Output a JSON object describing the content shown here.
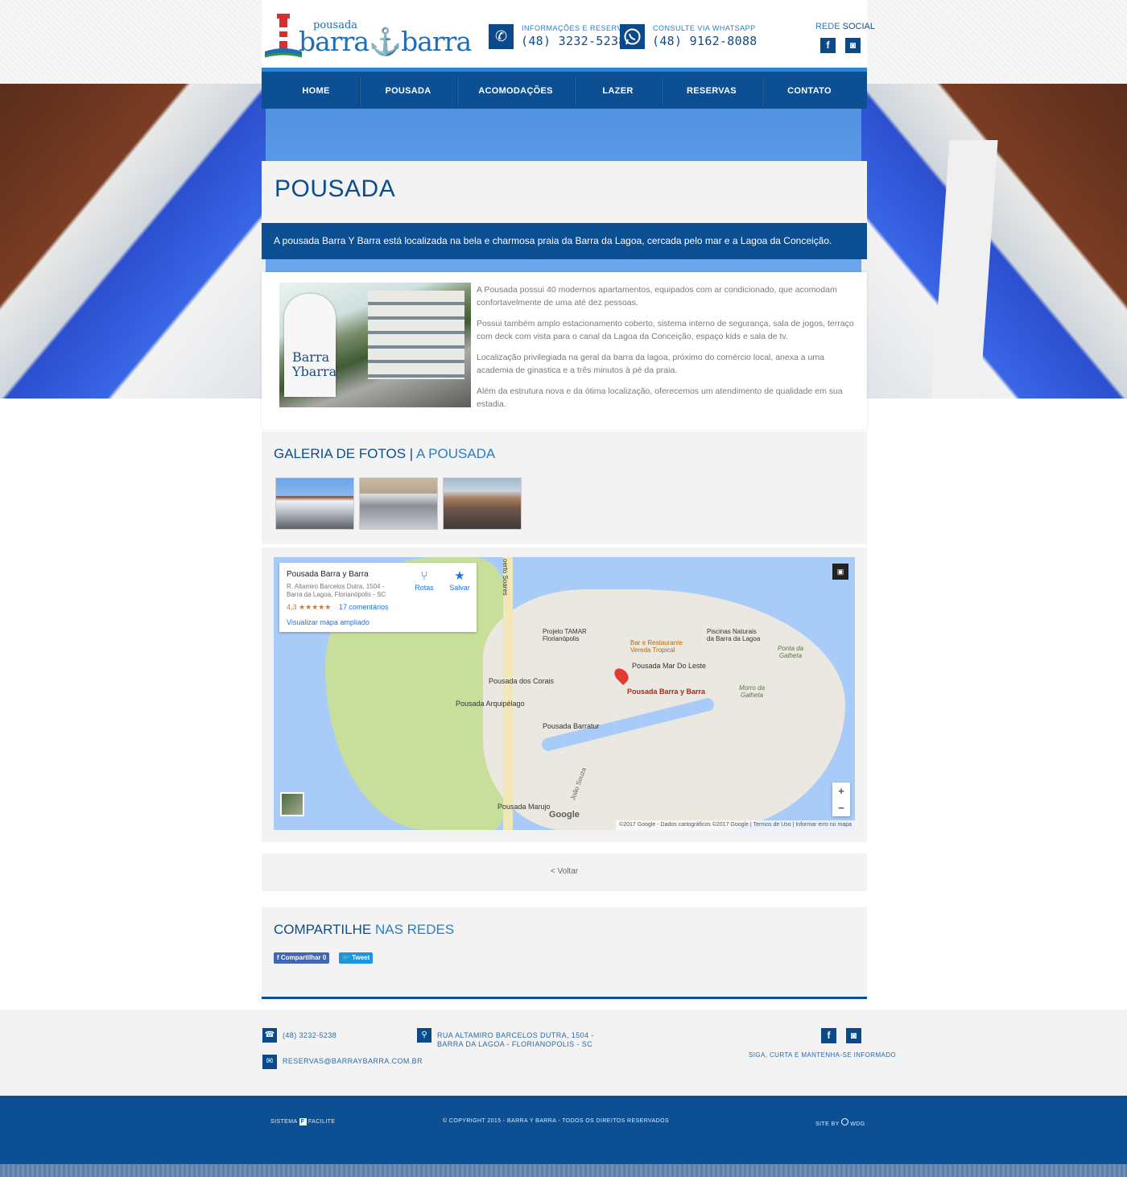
{
  "header": {
    "logo_small": "pousada",
    "logo_main": "barra⚓barra",
    "phone_label": "INFORMAÇÕES E RESERVAS",
    "phone_number": "(48) 3232-5238",
    "whatsapp_label": "CONSULTE VIA WHATSAPP",
    "whatsapp_number": "(48) 9162-8088",
    "social_a": "REDE",
    "social_b": "SOCIAL"
  },
  "nav": {
    "items": [
      "HOME",
      "POUSADA",
      "ACOMODAÇÕES",
      "LAZER",
      "RESERVAS",
      "CONTATO"
    ]
  },
  "page": {
    "title": "POUSADA",
    "intro": "A pousada Barra Y Barra está localizada na bela e charmosa praia da Barra da Lagoa, cercada pelo mar e a Lagoa da Conceição.",
    "sign_text": "Barra\nYbarra",
    "paragraphs": [
      "A Pousada possui 40 modernos apartamentos, equipados com ar condicionado, que acomodam confortavelmente de uma até dez pessoas.",
      "Possui também amplo estacionamento coberto, sistema interno de segurança, sala de jogos, terraço com deck com vista para o canal da Lagoa da Conceição, espaço kids e sala de tv.",
      "Localização privilegiada na geral da barra da lagoa, próximo do comércio local, anexa a uma academia de ginastica e a três minutos à pé da praia.",
      "Além da estrutura nova e da ótima localização, oferecemos um atendimento de qualidade em sua estadia."
    ]
  },
  "gallery": {
    "title_a": "GALERIA DE FOTOS",
    "title_sep": " | ",
    "title_b": "A POUSADA"
  },
  "map": {
    "card_name": "Pousada Barra y Barra",
    "card_address": "R. Altamiro Barcelos Dutra, 1504 - Barra da Lagoa, Florianópolis - SC",
    "card_rating": "4,3 ★★★★★",
    "card_reviews": "17 comentários",
    "card_link": "Visualizar mapa ampliado",
    "btn_routes": "Rotas",
    "btn_save": "Salvar",
    "pin_label": "Pousada Barra y Barra",
    "places": {
      "road": "oerto Soares",
      "tamar": "Projeto TAMAR\nFlorianópolis",
      "bar": "Bar e Restaurante\nVereda Tropical",
      "piscinas": "Piscinas Naturais\nda Barra da Lagoa",
      "ponta": "Ponta da\nGalheta",
      "mar_leste": "Pousada Mar Do Leste",
      "corais": "Pousada dos Corais",
      "arquipelago": "Pousada Arquipélago",
      "morro": "Morro da\nGalheta",
      "barratur": "Pousada Barratur",
      "marujo": "Pousada Marujo",
      "rua": "João Souza"
    },
    "google": "Google",
    "footer": "©2017 Google - Dados cartográficos ©2017 Google | Termos de Uso | Informar erro no mapa"
  },
  "back": {
    "label": "< Voltar"
  },
  "share": {
    "title_a": "COMPARTILHE",
    "title_b": "NAS REDES",
    "fb_label": "f Compartilhar 0",
    "tw_label": "🐦 Tweet"
  },
  "footer": {
    "phone": "(48) 3232-5238",
    "email": "RESERVAS@BARRAYBARRA.COM.BR",
    "address": "RUA ALTAMIRO BARCELOS DUTRA, 1504 - BARRA DA LAGOA - FLORIANOPOLIS - SC",
    "tagline": "SIGA, CURTA E MANTENHA-SE INFORMADO",
    "system_a": "SISTEMA",
    "system_b": "FACILITE",
    "copyright": "© COPYRIGHT 2015 - BARRA Y BARRA - TODOS OS DIREITOS RESERVADOS",
    "site_by_a": "SITE BY",
    "site_by_b": "WDG"
  },
  "colors": {
    "brand_dark": "#0c4f93",
    "brand_light": "#2a7ec4",
    "panel_bg": "#f3f3f3"
  }
}
